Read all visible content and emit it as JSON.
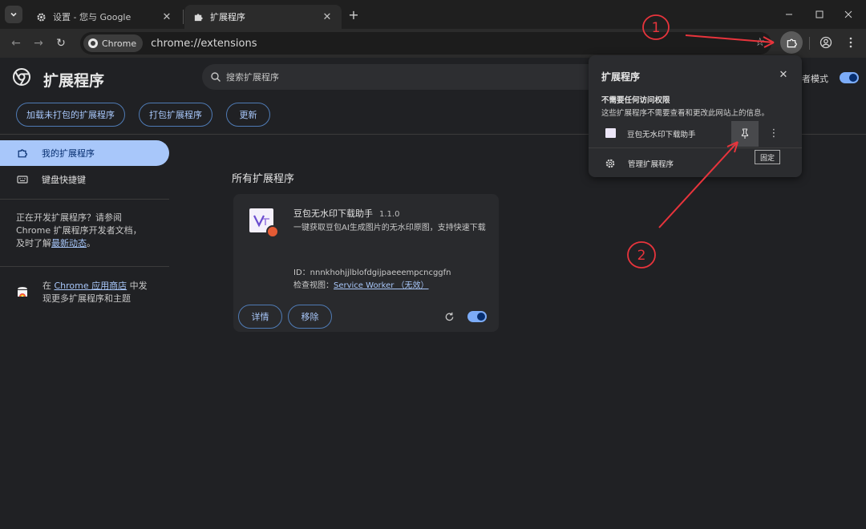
{
  "tabs": [
    {
      "label": "设置 - 您与 Google",
      "icon": "gear-icon"
    },
    {
      "label": "扩展程序",
      "icon": "puzzle-icon"
    }
  ],
  "omnibox": {
    "chip": "Chrome",
    "url": "chrome://extensions"
  },
  "header": {
    "title": "扩展程序",
    "search_placeholder": "搜索扩展程序",
    "dev_mode_label": "者模式",
    "dev_mode_on": true
  },
  "actions": {
    "load_unpacked": "加载未打包的扩展程序",
    "pack": "打包扩展程序",
    "update": "更新"
  },
  "sidebar": {
    "my_extensions": "我的扩展程序",
    "shortcuts": "键盘快捷键",
    "dev_text_1": "正在开发扩展程序？请参阅",
    "dev_text_2": "Chrome 扩展程序开发者文档，",
    "dev_text_3a": "及时了解",
    "dev_text_3_link": "最新动态",
    "dev_text_3b": "。",
    "store_text_1a": "在 ",
    "store_link": "Chrome 应用商店",
    "store_text_1b": " 中发",
    "store_text_2": "现更多扩展程序和主题"
  },
  "main": {
    "section_title": "所有扩展程序",
    "card": {
      "name": "豆包无水印下载助手",
      "version": "1.1.0",
      "description": "一键获取豆包AI生成图片的无水印原图，支持快速下载",
      "id_label": "ID：",
      "id_value": "nnnkhohjjlblofdgijpaeeempcncggfn",
      "view_label": "检查视图：",
      "view_link": "Service Worker （无效）",
      "details": "详情",
      "remove": "移除",
      "enabled": true
    }
  },
  "popup": {
    "title": "扩展程序",
    "heading": "不需要任何访问权限",
    "subtitle": "这些扩展程序不需要查看和更改此网站上的信息。",
    "ext_name": "豆包无水印下载助手",
    "manage": "管理扩展程序",
    "pin_tooltip": "固定"
  },
  "annotations": {
    "step1": "1",
    "step2": "2",
    "color": "#e8343c"
  }
}
